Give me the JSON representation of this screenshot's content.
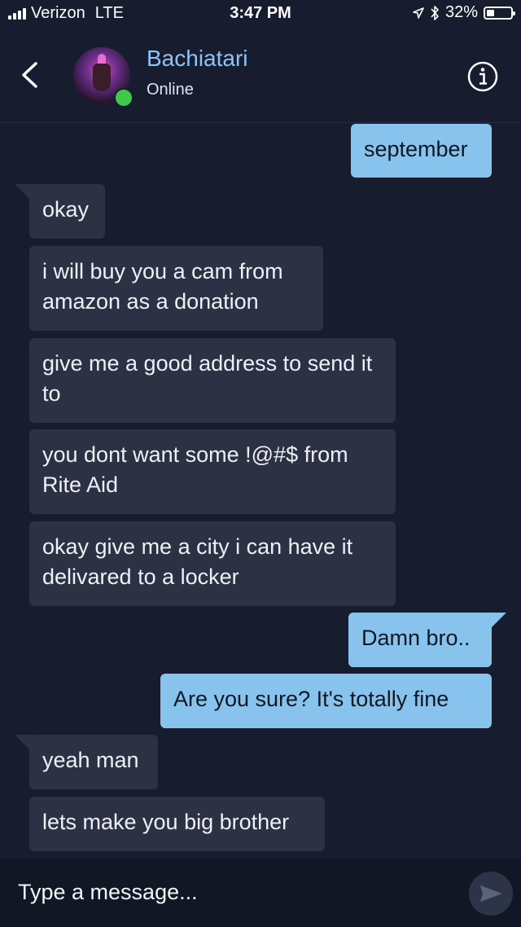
{
  "status_bar": {
    "carrier": "Verizon",
    "network": "LTE",
    "time": "3:47 PM",
    "battery": "32%",
    "battery_level": 0.32
  },
  "header": {
    "contact_name": "Bachiatari",
    "presence": "Online",
    "presence_color": "#3fc94a"
  },
  "messages": [
    {
      "direction": "outgoing",
      "text": "september"
    },
    {
      "direction": "incoming",
      "text": "okay"
    },
    {
      "direction": "incoming",
      "text": "i will buy you a cam from amazon as a donation"
    },
    {
      "direction": "incoming",
      "text": "give me a good address to send it to"
    },
    {
      "direction": "incoming",
      "text": "you dont want some !@#$ from Rite Aid"
    },
    {
      "direction": "incoming",
      "text": "okay give me a city i can have it delivared to a locker"
    },
    {
      "direction": "outgoing",
      "text": "Damn bro.."
    },
    {
      "direction": "outgoing",
      "text": "Are you sure? It's totally fine"
    },
    {
      "direction": "incoming",
      "text": "yeah man"
    },
    {
      "direction": "incoming",
      "text": "lets make you big brother"
    }
  ],
  "composer": {
    "placeholder": "Type a message..."
  },
  "icons": {
    "back": "chevron-left-icon",
    "info": "info-icon",
    "send": "send-icon"
  },
  "colors": {
    "background": "#171d2e",
    "incoming_bubble": "#2c3244",
    "outgoing_bubble": "#88c3ee",
    "name": "#8fc3f5"
  }
}
